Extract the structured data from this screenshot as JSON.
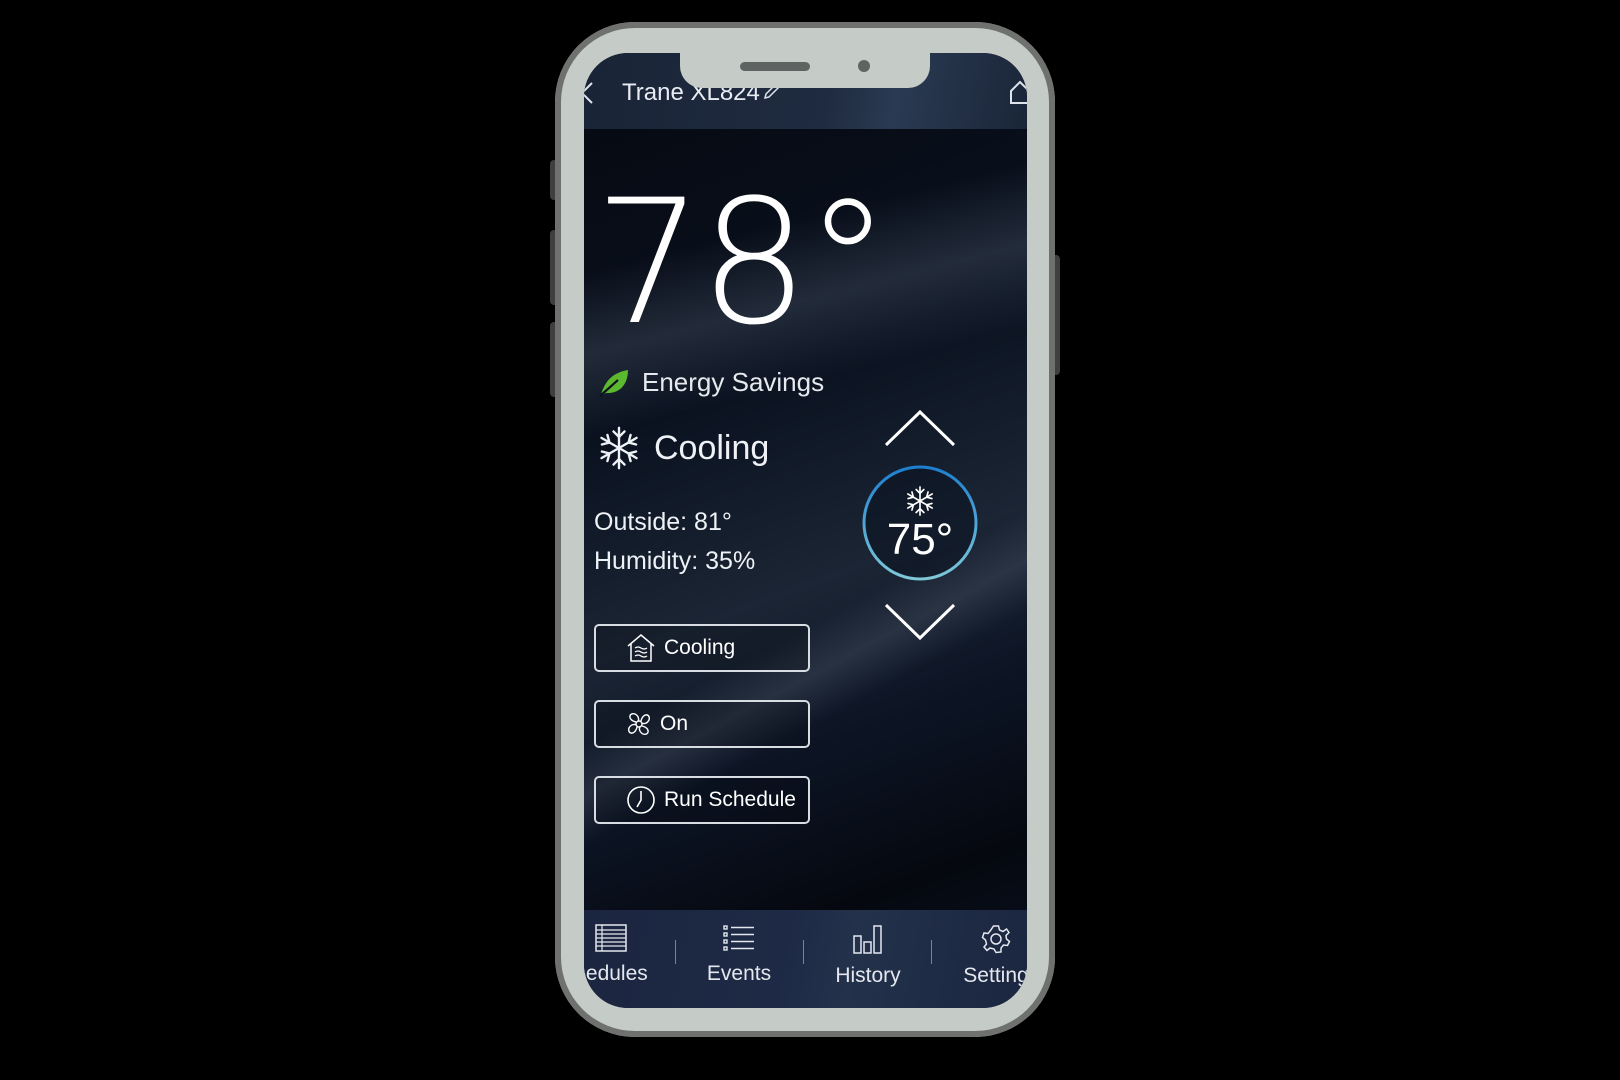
{
  "header": {
    "device_name": "Trane XL824",
    "back_icon": "chevron-left-icon",
    "edit_icon": "pencil-icon",
    "home_icon": "home-icon"
  },
  "status": {
    "indoor_temp": "78°",
    "energy_label": "Energy Savings",
    "energy_icon": "leaf-icon",
    "energy_color": "#5cb82e",
    "mode_label": "Cooling",
    "mode_icon": "snowflake-icon",
    "outside": "Outside: 81°",
    "humidity": "Humidity: 35%"
  },
  "setpoint": {
    "value": "75°",
    "icon": "snowflake-icon",
    "ring_color_top": "#1e7fd0",
    "ring_color_bottom": "#7ec8d8",
    "increase_icon": "chevron-up-icon",
    "decrease_icon": "chevron-down-icon"
  },
  "buttons": [
    {
      "label": "Cooling",
      "icon": "house-waves-icon"
    },
    {
      "label": "On",
      "icon": "fan-icon"
    },
    {
      "label": "Run Schedule",
      "icon": "clock-icon"
    }
  ],
  "bottom_nav": [
    {
      "label": "hedules",
      "icon": "schedule-grid-icon"
    },
    {
      "label": "Events",
      "icon": "list-icon"
    },
    {
      "label": "History",
      "icon": "bar-chart-icon"
    },
    {
      "label": "Setting",
      "icon": "gear-icon"
    }
  ]
}
